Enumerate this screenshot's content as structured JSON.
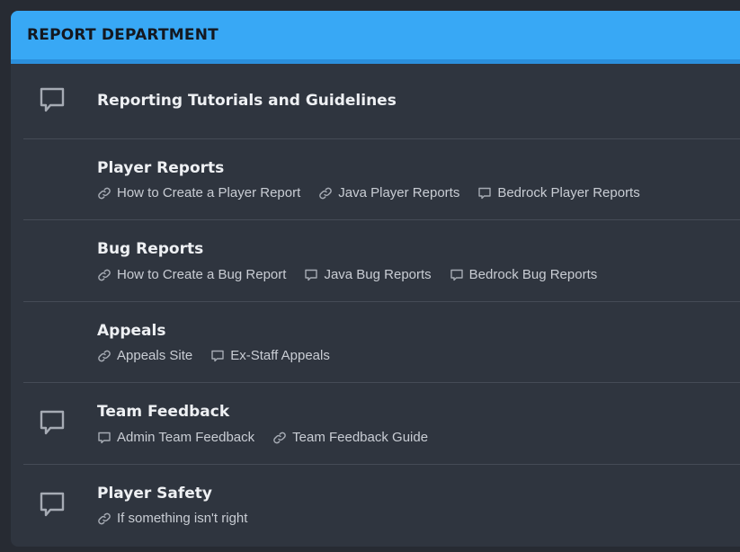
{
  "header": {
    "title": "REPORT DEPARTMENT"
  },
  "rows": [
    {
      "title": "Reporting Tutorials and Guidelines",
      "icon": "chat-bubble-icon",
      "links": []
    },
    {
      "title": "Player Reports",
      "icon": null,
      "links": [
        {
          "label": "How to Create a Player Report",
          "icon": "link-icon"
        },
        {
          "label": "Java Player Reports",
          "icon": "link-icon"
        },
        {
          "label": "Bedrock Player Reports",
          "icon": "chat-bubble-icon"
        }
      ]
    },
    {
      "title": "Bug Reports",
      "icon": null,
      "links": [
        {
          "label": "How to Create a Bug Report",
          "icon": "link-icon"
        },
        {
          "label": "Java Bug Reports",
          "icon": "chat-bubble-icon"
        },
        {
          "label": "Bedrock Bug Reports",
          "icon": "chat-bubble-icon"
        }
      ]
    },
    {
      "title": "Appeals",
      "icon": null,
      "links": [
        {
          "label": "Appeals Site",
          "icon": "link-icon"
        },
        {
          "label": "Ex-Staff Appeals",
          "icon": "chat-bubble-icon"
        }
      ]
    },
    {
      "title": "Team Feedback",
      "icon": "chat-bubble-icon",
      "links": [
        {
          "label": "Admin Team Feedback",
          "icon": "chat-bubble-icon"
        },
        {
          "label": "Team Feedback Guide",
          "icon": "link-icon"
        }
      ]
    },
    {
      "title": "Player Safety",
      "icon": "chat-bubble-icon",
      "links": [
        {
          "label": "If something isn't right",
          "icon": "link-icon"
        }
      ]
    }
  ],
  "colors": {
    "accent": "#38a8f5",
    "panel": "#2f353f",
    "background": "#272b33"
  }
}
